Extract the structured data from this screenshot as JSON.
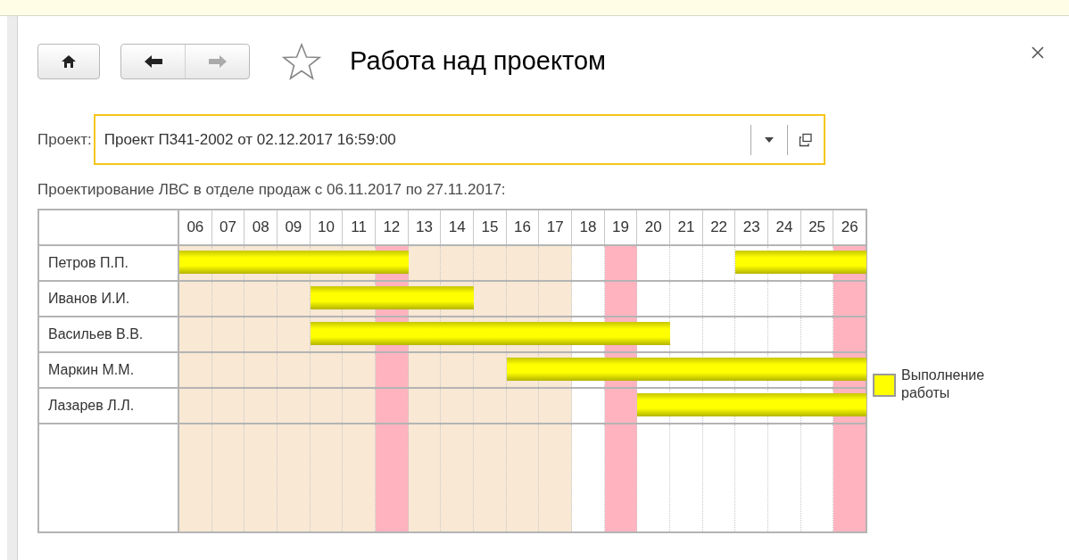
{
  "window": {
    "title": "Работа над проектом"
  },
  "project": {
    "label": "Проект:",
    "value": "Проект П341-2002 от 02.12.2017 16:59:00"
  },
  "caption": "Проектирование ЛВС в отделе продаж с 06.11.2017 по 27.11.2017:",
  "gantt": {
    "days": [
      {
        "label": "06",
        "kind": "period"
      },
      {
        "label": "07",
        "kind": "period"
      },
      {
        "label": "08",
        "kind": "period"
      },
      {
        "label": "09",
        "kind": "period"
      },
      {
        "label": "10",
        "kind": "period"
      },
      {
        "label": "11",
        "kind": "period"
      },
      {
        "label": "12",
        "kind": "holiday"
      },
      {
        "label": "13",
        "kind": "period"
      },
      {
        "label": "14",
        "kind": "period"
      },
      {
        "label": "15",
        "kind": "period"
      },
      {
        "label": "16",
        "kind": "period"
      },
      {
        "label": "17",
        "kind": "period"
      },
      {
        "label": "18",
        "kind": "normal"
      },
      {
        "label": "19",
        "kind": "holiday"
      },
      {
        "label": "20",
        "kind": "normal"
      },
      {
        "label": "21",
        "kind": "normal"
      },
      {
        "label": "22",
        "kind": "normal"
      },
      {
        "label": "23",
        "kind": "normal"
      },
      {
        "label": "24",
        "kind": "normal"
      },
      {
        "label": "25",
        "kind": "normal"
      },
      {
        "label": "26",
        "kind": "holiday"
      }
    ],
    "rows": [
      {
        "name": "Петров П.П.",
        "worked": [
          true,
          true,
          true,
          true,
          true,
          true,
          true,
          false,
          false,
          false,
          false,
          false,
          false,
          false,
          false,
          false,
          false,
          true,
          true,
          true,
          true
        ]
      },
      {
        "name": "Иванов И.И.",
        "worked": [
          false,
          false,
          false,
          false,
          true,
          true,
          true,
          true,
          true,
          false,
          false,
          false,
          false,
          false,
          false,
          false,
          false,
          false,
          false,
          false,
          false
        ]
      },
      {
        "name": "Васильев В.В.",
        "worked": [
          false,
          false,
          false,
          false,
          true,
          true,
          true,
          true,
          true,
          true,
          true,
          true,
          true,
          true,
          true,
          false,
          false,
          false,
          false,
          false,
          false
        ]
      },
      {
        "name": "Маркин М.М.",
        "worked": [
          false,
          false,
          false,
          false,
          false,
          false,
          false,
          false,
          false,
          false,
          true,
          true,
          true,
          true,
          true,
          true,
          true,
          true,
          true,
          true,
          true
        ]
      },
      {
        "name": "Лазарев Л.Л.",
        "worked": [
          false,
          false,
          false,
          false,
          false,
          false,
          false,
          false,
          false,
          false,
          false,
          false,
          false,
          false,
          true,
          true,
          true,
          true,
          true,
          true,
          true
        ]
      }
    ]
  },
  "legend": [
    {
      "label": "Выполнение работы",
      "color": "#ffff00"
    }
  ]
}
